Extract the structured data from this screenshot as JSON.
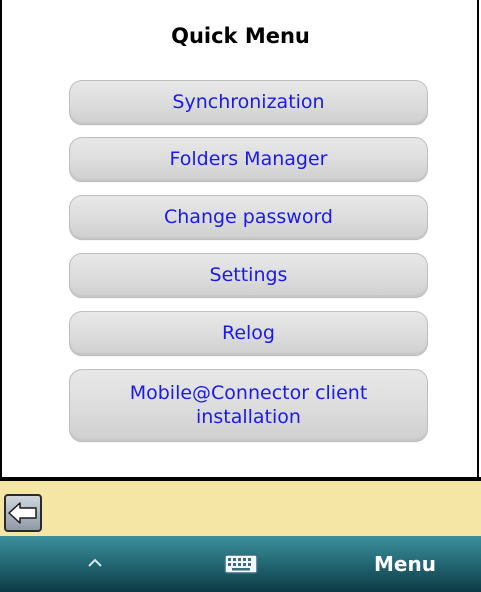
{
  "title": "Quick Menu",
  "menu_buttons": [
    {
      "label": "Synchronization"
    },
    {
      "label": "Folders Manager"
    },
    {
      "label": "Change password"
    },
    {
      "label": "Settings"
    },
    {
      "label": "Relog"
    },
    {
      "label_line1": "Mobile@Connector client",
      "label_line2": "installation"
    }
  ],
  "status_bar": {
    "background": "#f5e6a6",
    "back_icon": "back-arrow-icon"
  },
  "softkeys": {
    "left_icon": "chevron-up-icon",
    "center_icon": "keyboard-icon",
    "right_label": "Menu"
  },
  "colors": {
    "button_text": "#1a1ae6",
    "softkey_bar": "#246b77"
  }
}
